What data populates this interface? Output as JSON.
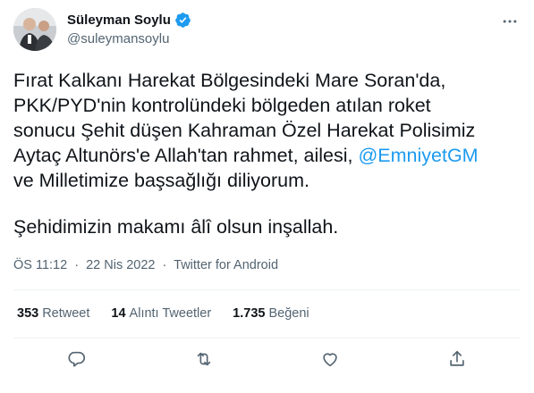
{
  "author": {
    "display_name": "Süleyman Soylu",
    "handle": "@suleymansoylu",
    "verified": true
  },
  "tweet": {
    "lines": [
      "Fırat Kalkanı Harekat Bölgesindeki Mare Soran'da,",
      "PKK/PYD'nin kontrolündeki bölgeden atılan roket",
      "sonucu Şehit düşen Kahraman Özel Harekat Polisimiz"
    ],
    "line4_before": "Aytaç Altunörs'e Allah'tan rahmet, ailesi, ",
    "mention": "@EmniyetGM",
    "line5": "ve Milletimize başsağlığı diliyorum.",
    "paragraph2": "Şehidimizin makamı âlî olsun inşallah."
  },
  "meta": {
    "time": "ÖS 11:12",
    "separator": "·",
    "date": "22 Nis 2022",
    "source": "Twitter for Android"
  },
  "stats": {
    "retweets_count": "353",
    "retweets_label": "Retweet",
    "quotes_count": "14",
    "quotes_label": "Alıntı Tweetler",
    "likes_count": "1.735",
    "likes_label": "Beğeni"
  },
  "colors": {
    "link": "#1d9bf0",
    "secondary_text": "#536471",
    "divider": "#eff3f4",
    "icon": "#536471"
  },
  "icons": {
    "more": "more-dots-icon",
    "reply": "reply-icon",
    "retweet": "retweet-icon",
    "like": "heart-icon",
    "share": "share-icon",
    "verified": "verified-badge-icon"
  }
}
